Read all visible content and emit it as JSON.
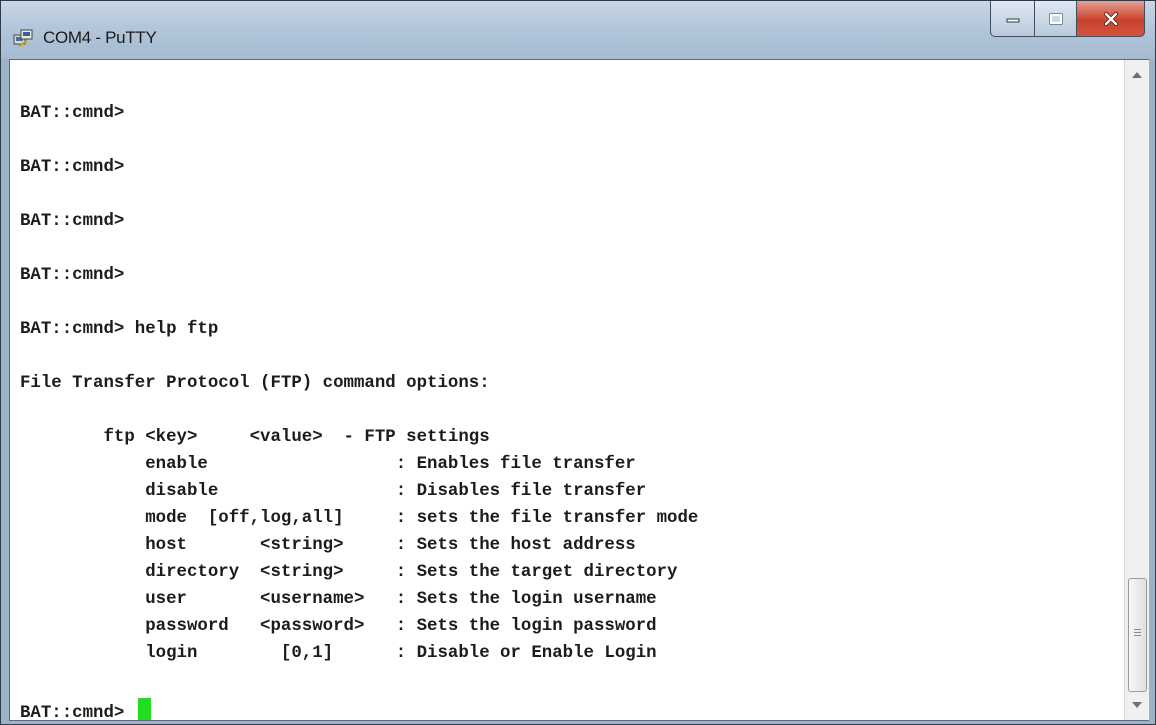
{
  "window": {
    "title": "COM4 - PuTTY",
    "icon": "putty-icon"
  },
  "controls": {
    "minimize_icon": "minimize-icon",
    "maximize_icon": "maximize-icon",
    "close_icon": "close-icon",
    "close_color": "#c8412c"
  },
  "terminal": {
    "lines": [
      "BAT::cmnd>",
      "BAT::cmnd>",
      "BAT::cmnd>",
      "BAT::cmnd>",
      "BAT::cmnd> help ftp",
      "File Transfer Protocol (FTP) command options:",
      "        ftp <key>     <value>  - FTP settings",
      "            enable                  : Enables file transfer",
      "            disable                 : Disables file transfer",
      "            mode  [off,log,all]     : sets the file transfer mode",
      "            host       <string>     : Sets the host address",
      "            directory  <string>     : Sets the target directory",
      "            user       <username>   : Sets the login username",
      "            password   <password>   : Sets the login password",
      "            login        [0,1]      : Disable or Enable Login"
    ],
    "prompt": "BAT::cmnd> ",
    "cursor_color": "#22dd22"
  },
  "scrollbar": {
    "up_icon": "scroll-up-arrow-icon",
    "down_icon": "scroll-down-arrow-icon"
  }
}
